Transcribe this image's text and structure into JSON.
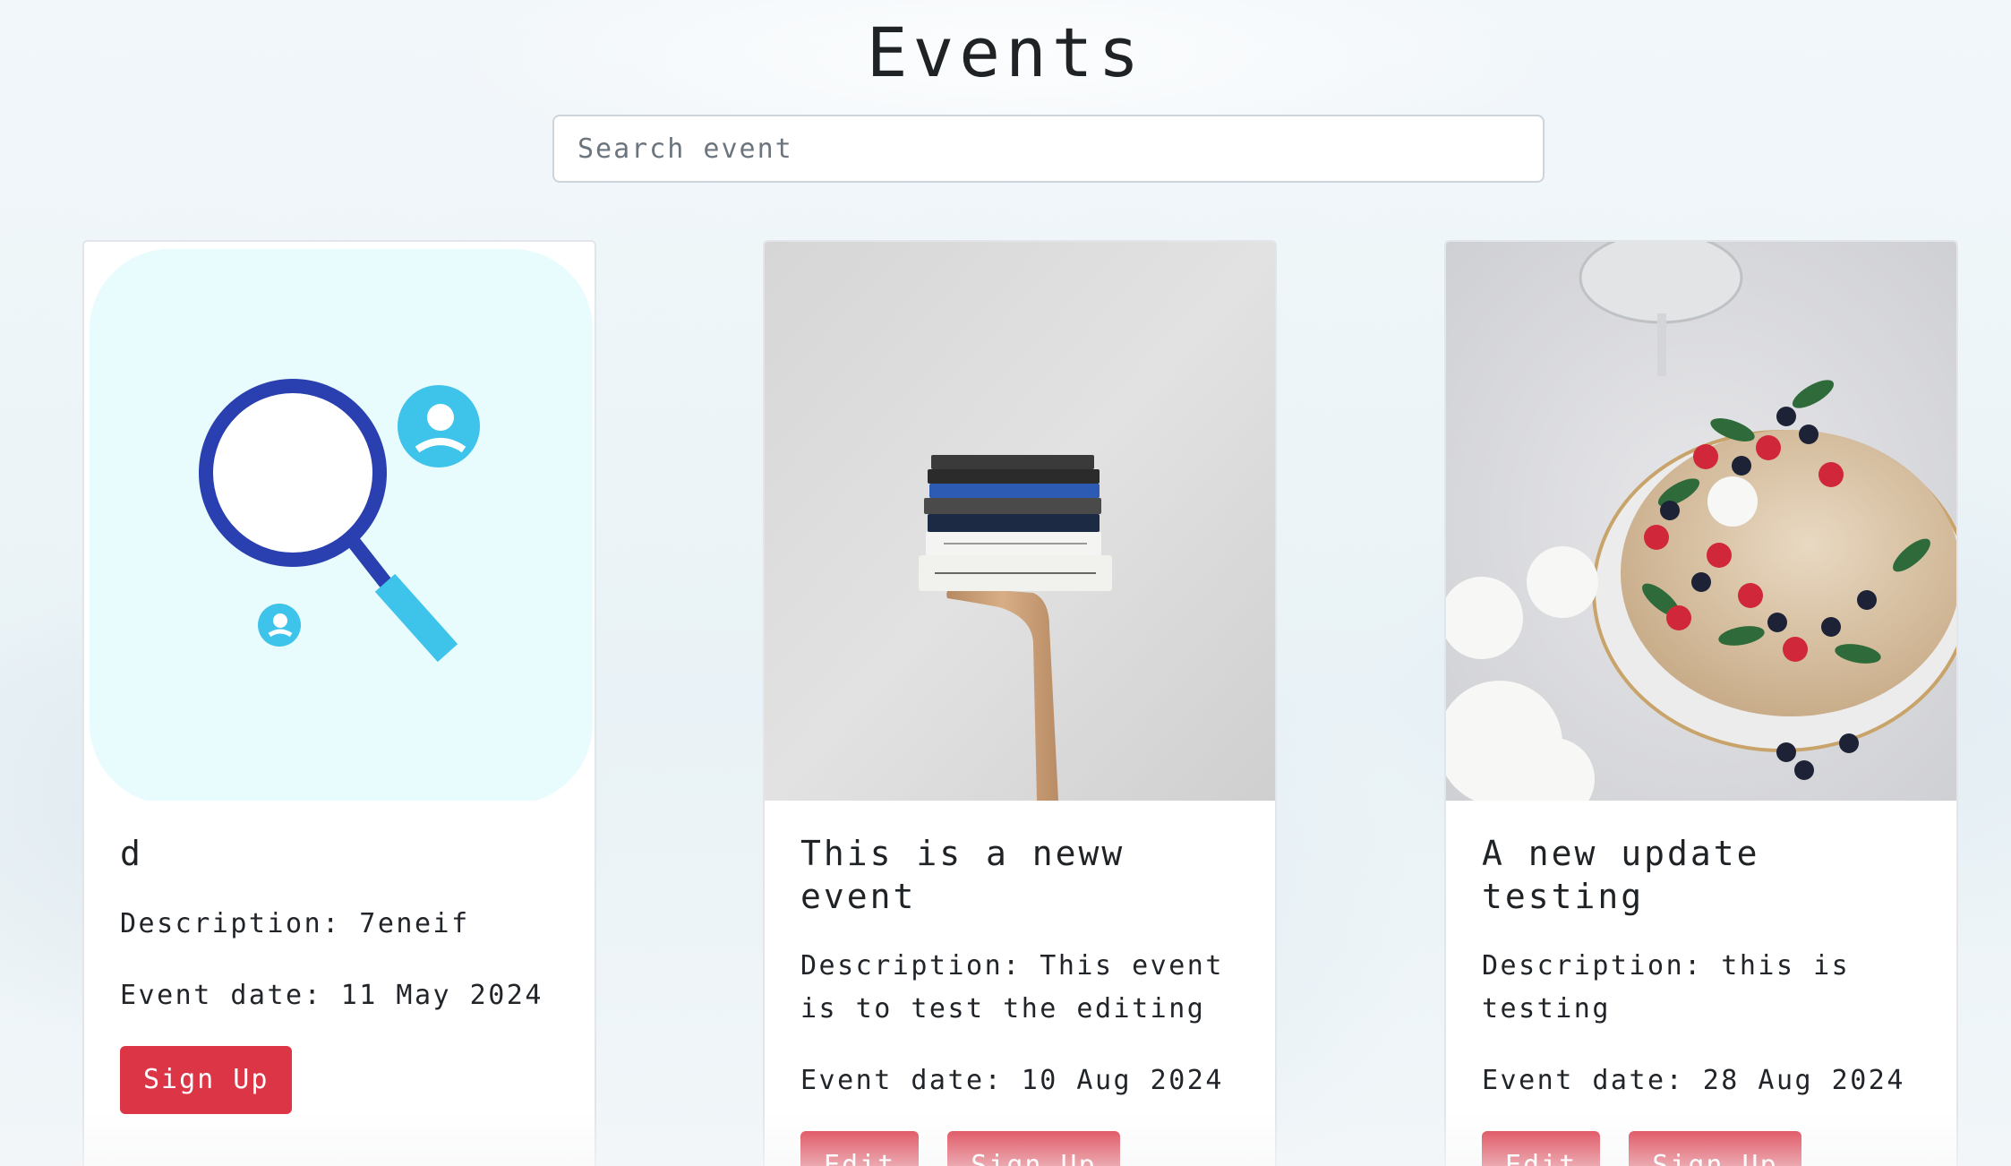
{
  "page": {
    "title": "Events"
  },
  "search": {
    "placeholder": "Search event",
    "value": ""
  },
  "events": [
    {
      "title": "d",
      "description": "Description: 7eneif",
      "date": "Event date: 11 May 2024",
      "image_icon": "search-people-icon",
      "buttons": {
        "signup": "Sign Up"
      }
    },
    {
      "title": "This is a neww event",
      "description": "Description: This event is to test the editing",
      "date": "Event date: 10 Aug 2024",
      "image_icon": "books-photo",
      "buttons": {
        "edit": "Edit",
        "signup": "Sign Up"
      }
    },
    {
      "title": "A new update testing",
      "description": "Description: this is testing",
      "date": "Event date: 28 Aug 2024",
      "image_icon": "cake-photo",
      "buttons": {
        "edit": "Edit",
        "signup": "Sign Up"
      }
    }
  ],
  "colors": {
    "button": "#dc3545",
    "icon_dark_blue": "#2a40b0",
    "icon_light_blue": "#3ec3ea",
    "icon_bg": "#e8fbfd"
  }
}
